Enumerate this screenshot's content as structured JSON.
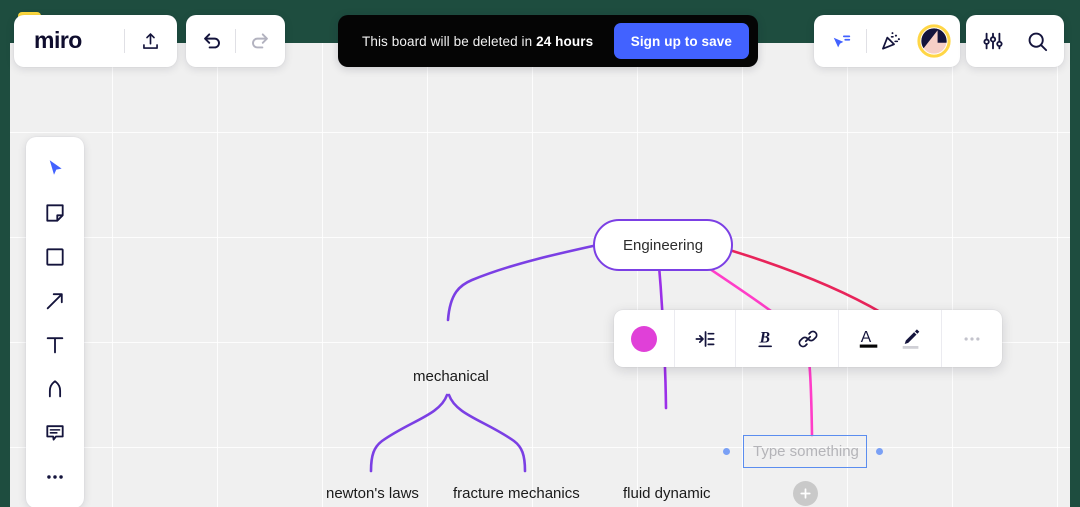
{
  "window": {
    "title": "Miro whiteboard",
    "app_icon": "miro-logo-icon",
    "frame_color": "#1e4d3f"
  },
  "toolbar_left": {
    "brand": "miro",
    "upload_icon": "upload-icon",
    "undo_icon": "undo-icon",
    "redo_icon": "redo-icon"
  },
  "banner": {
    "message_prefix": "This board will be deleted in ",
    "message_time": "24 hours",
    "cta_label": "Sign up to save",
    "cta_color": "#4262FF",
    "background": "#050505"
  },
  "toolbar_right": {
    "present_icon": "present-cursor-icon",
    "celebrate_icon": "party-popper-icon",
    "avatar_icon": "user-avatar",
    "settings_icon": "sliders-icon",
    "search_icon": "search-icon"
  },
  "tools": [
    {
      "name": "select-tool",
      "icon": "cursor-icon",
      "selected": true
    },
    {
      "name": "sticky-note-tool",
      "icon": "sticky-note-icon",
      "selected": false
    },
    {
      "name": "shape-tool",
      "icon": "square-icon",
      "selected": false
    },
    {
      "name": "arrow-tool",
      "icon": "arrow-icon",
      "selected": false
    },
    {
      "name": "text-tool",
      "icon": "text-t-icon",
      "selected": false
    },
    {
      "name": "pen-tool",
      "icon": "marker-icon",
      "selected": false
    },
    {
      "name": "comment-tool",
      "icon": "comment-icon",
      "selected": false
    },
    {
      "name": "more-tools",
      "icon": "ellipsis-icon",
      "selected": false
    }
  ],
  "format_bar": {
    "color_swatch": "#E040D8",
    "layout_icon": "indent-layout-icon",
    "bold_label": "B",
    "link_icon": "link-icon",
    "text_color_label": "A",
    "text_color_underline": "#050505",
    "highlighter_icon": "marker-pen-icon",
    "more_icon": "ellipsis-icon"
  },
  "mindmap": {
    "root": {
      "label": "Engineering",
      "border_color": "#7B3FE4"
    },
    "branches": [
      {
        "label": "mechanical",
        "color": "#7B3FE4"
      },
      {
        "label": "fluid dynamic",
        "color": "#9B2FE8"
      },
      {
        "label": "",
        "color": "#FF3DC8"
      },
      {
        "label": "",
        "color": "#E8245A"
      }
    ],
    "leaves": [
      {
        "label": "newton's laws",
        "color": "#7B3FE4"
      },
      {
        "label": "fracture mechanics",
        "color": "#7B3FE4"
      },
      {
        "label": "fluid dynamic",
        "color": "#9B2FE8"
      }
    ],
    "editing_node": {
      "placeholder": "Type something",
      "value": "",
      "border_color": "#5b8def",
      "connector_color": "#FF3DC8"
    },
    "add_child_button": "+"
  }
}
